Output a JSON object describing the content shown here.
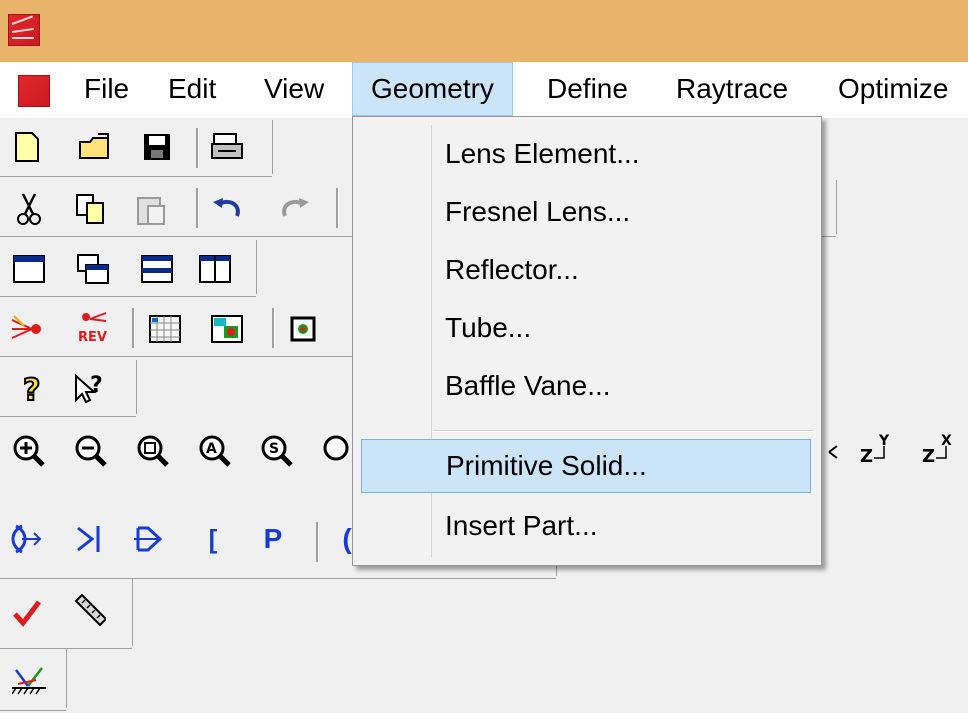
{
  "menubar": {
    "items": [
      "File",
      "Edit",
      "View",
      "Geometry",
      "Define",
      "Raytrace",
      "Optimize"
    ],
    "active": "Geometry"
  },
  "geometry_menu": {
    "items": [
      {
        "label": "Lens Element..."
      },
      {
        "label": "Fresnel Lens..."
      },
      {
        "label": "Reflector..."
      },
      {
        "label": "Tube..."
      },
      {
        "label": "Baffle Vane..."
      },
      {
        "label": "Primitive Solid...",
        "highlighted": true
      },
      {
        "label": "Insert Part..."
      }
    ]
  },
  "toolbar_glyphs": {
    "help_question": "?",
    "pointer_question": "?",
    "zoom_a": "A",
    "zoom_s": "S",
    "zy_top": "Y",
    "zy_base": "Z",
    "zx_top": "X",
    "zx_base": "Z",
    "letter_p": "P",
    "bracket": "[",
    "paren": "(",
    "rev_label": "REV"
  },
  "colors": {
    "titlebar": "#e8b36b",
    "menu_active": "#cce4f7",
    "logo_red": "#d8222a"
  }
}
